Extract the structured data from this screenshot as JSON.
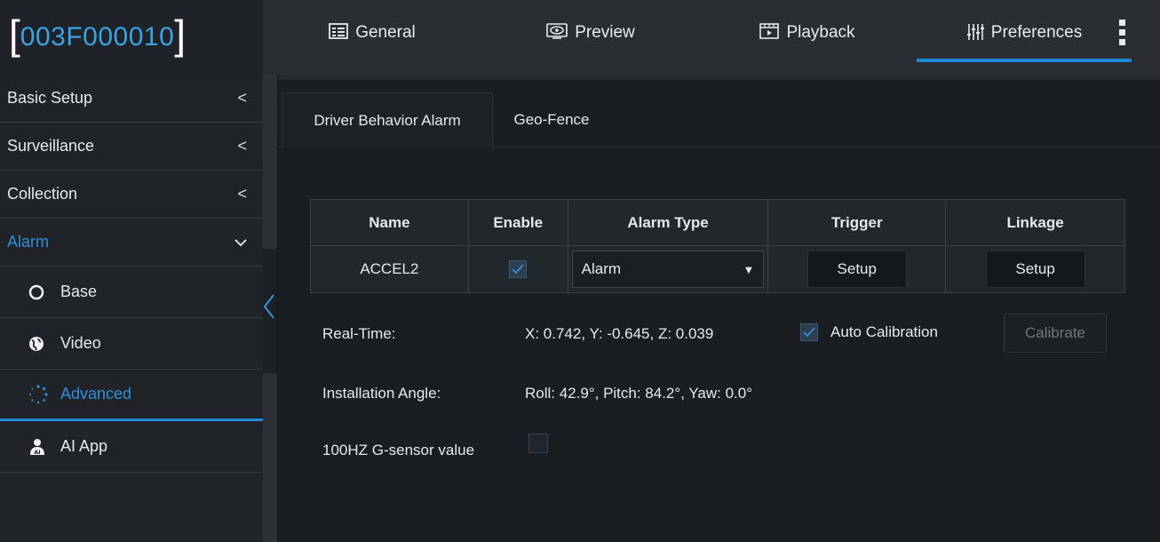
{
  "header": {
    "device_id": "003F000010",
    "bracket_open": "[",
    "bracket_close": "]",
    "tabs": [
      {
        "label": "General",
        "icon": "list-icon"
      },
      {
        "label": "Preview",
        "icon": "eye-icon"
      },
      {
        "label": "Playback",
        "icon": "playback-icon"
      },
      {
        "label": "Preferences",
        "icon": "sliders-icon",
        "active": true
      }
    ]
  },
  "sidebar": {
    "items": [
      {
        "label": "Basic Setup",
        "chevron": "<"
      },
      {
        "label": "Surveillance",
        "chevron": "<"
      },
      {
        "label": "Collection",
        "chevron": "<"
      },
      {
        "label": "Alarm",
        "chevron": "⌄",
        "open": true
      }
    ],
    "sub_items": [
      {
        "label": "Base",
        "icon": "circle-icon"
      },
      {
        "label": "Video",
        "icon": "globe-icon"
      },
      {
        "label": "Advanced",
        "icon": "dotted-circle-icon",
        "active": true
      },
      {
        "label": "AI App",
        "icon": "ai-person-icon"
      }
    ],
    "collapse_glyph": "<"
  },
  "content": {
    "subtabs": [
      {
        "label": "Driver Behavior Alarm",
        "active": true
      },
      {
        "label": "Geo-Fence"
      }
    ],
    "table": {
      "headers": [
        "Name",
        "Enable",
        "Alarm Type",
        "Trigger",
        "Linkage"
      ],
      "row": {
        "name": "ACCEL2",
        "enabled": true,
        "alarm_type": "Alarm",
        "dropdown_arrow": "▼",
        "trigger_button": "Setup",
        "linkage_button": "Setup"
      }
    },
    "realtime": {
      "label": "Real-Time:",
      "value": "X: 0.742, Y: -0.645, Z: 0.039",
      "auto_calibration_label": "Auto Calibration",
      "auto_calibration_checked": true,
      "calibrate_button": "Calibrate"
    },
    "installation": {
      "label": "Installation Angle:",
      "value": "Roll: 42.9°, Pitch: 84.2°, Yaw: 0.0°"
    },
    "gsensor": {
      "label": "100HZ G-sensor value",
      "checked": false
    }
  },
  "colors": {
    "accent": "#1e88d2",
    "device_id": "#39a3e6",
    "background": "#1a1e22",
    "topbar": "#2a2e33"
  }
}
